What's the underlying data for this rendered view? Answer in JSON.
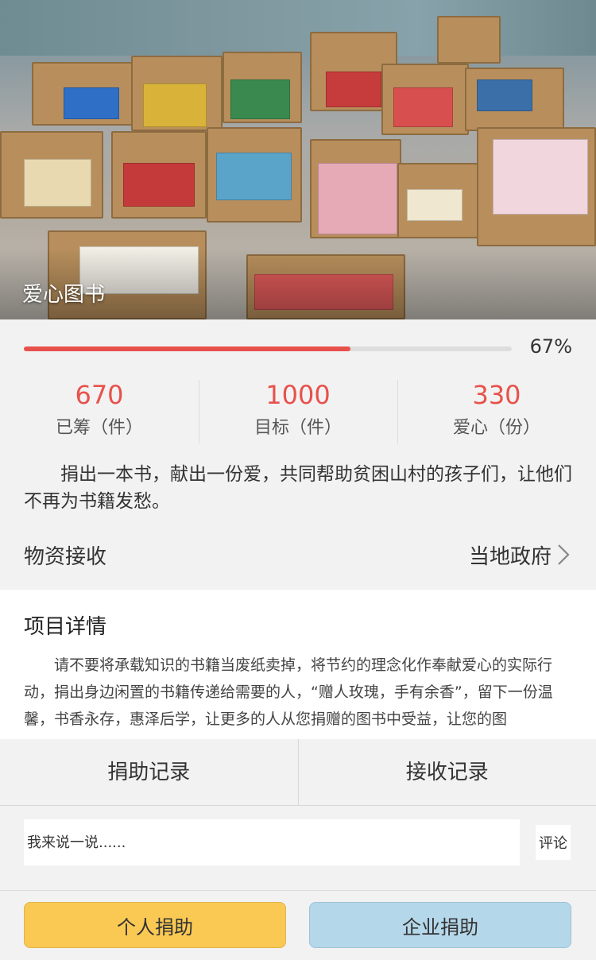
{
  "hero": {
    "title": "爱心图书",
    "image": "books-in-boxes-photo"
  },
  "progress": {
    "percent_label": "67%",
    "percent_value": 0.67,
    "fill_color": "#e8514b"
  },
  "stats": [
    {
      "value": "670",
      "label": "已筹（件）"
    },
    {
      "value": "1000",
      "label": "目标（件）"
    },
    {
      "value": "330",
      "label": "爱心（份）"
    }
  ],
  "summary": "捐出一本书，献出一份爱，共同帮助贫困山村的孩子们，让他们不再为书籍发愁。",
  "receive": {
    "label": "物资接收",
    "value": "当地政府",
    "icon": "chevron-right-icon"
  },
  "detail": {
    "title": "项目详情",
    "body": "请不要将承载知识的书籍当废纸卖掉，将节约的理念化作奉献爱心的实际行动，捐出身边闲置的书籍传递给需要的人，“赠人玫瑰，手有余香”，留下一份温馨，书香永存，惠泽后学，让更多的人从您捐赠的图书中受益，让您的图"
  },
  "tabs": {
    "donation_records": "捐助记录",
    "receipt_records": "接收记录"
  },
  "comment": {
    "placeholder": "我来说一说......",
    "button": "评论"
  },
  "actions": {
    "personal": "个人捐助",
    "company": "企业捐助",
    "personal_color": "#f9c954",
    "company_color": "#b5d7ea"
  }
}
